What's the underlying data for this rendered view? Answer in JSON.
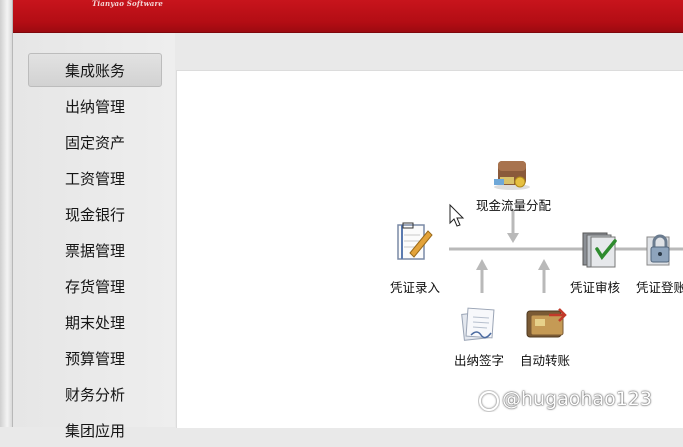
{
  "banner": {
    "brand": "Tianyao Software"
  },
  "sidebar": {
    "items": [
      {
        "label": "集成账务",
        "active": true
      },
      {
        "label": "出纳管理"
      },
      {
        "label": "固定资产"
      },
      {
        "label": "工资管理"
      },
      {
        "label": "现金银行"
      },
      {
        "label": "票据管理"
      },
      {
        "label": "存货管理"
      },
      {
        "label": "期末处理"
      },
      {
        "label": "预算管理"
      },
      {
        "label": "财务分析"
      },
      {
        "label": "集团应用"
      }
    ]
  },
  "flow": {
    "cash_flow_alloc": "现金流量分配",
    "voucher_entry": "凭证录入",
    "voucher_review": "凭证审核",
    "voucher_post": "凭证登账",
    "cashier_sign": "出纳签字",
    "auto_transfer": "自动转账"
  },
  "watermark": {
    "text": "@hugaohao123"
  },
  "colors": {
    "banner_red": "#c0121a",
    "flow_line": "#b9b9b9"
  }
}
